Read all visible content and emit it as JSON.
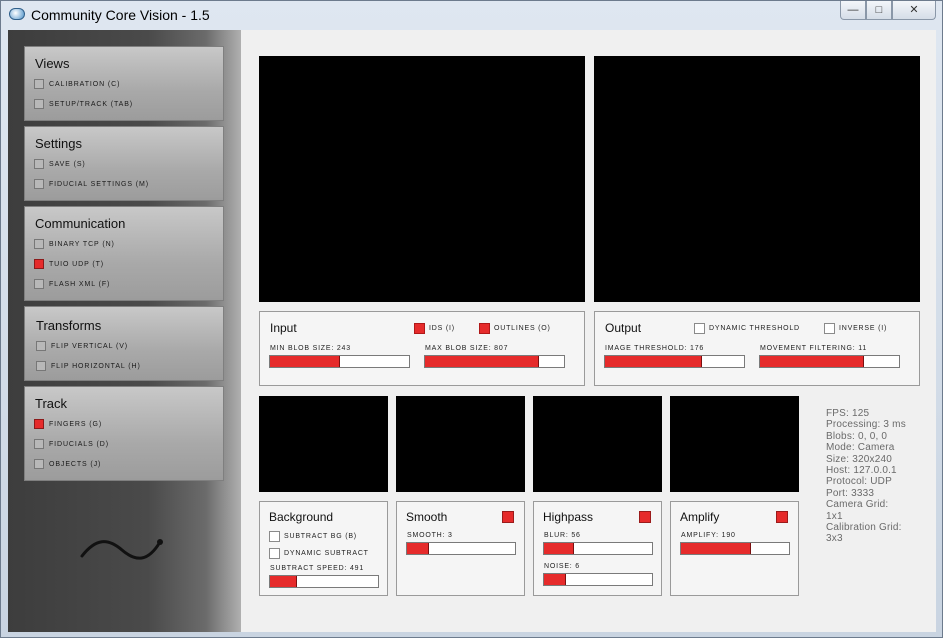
{
  "window": {
    "title": "Community Core Vision - 1.5",
    "controls": {
      "minimize": "—",
      "maximize": "□",
      "close": "✕"
    }
  },
  "colors": {
    "accent": "#e62b2b",
    "sidebar_dark": "#3d3d3d",
    "video_bg": "#000000"
  },
  "sidebar": {
    "panels": [
      {
        "title": "Views",
        "items": [
          {
            "label": "CALIBRATION (C)",
            "checked": false
          },
          {
            "label": "SETUP/TRACK (TAB)",
            "checked": false
          }
        ]
      },
      {
        "title": "Settings",
        "items": [
          {
            "label": "SAVE (S)",
            "checked": false
          },
          {
            "label": "FIDUCIAL SETTINGS (M)",
            "checked": false
          }
        ]
      },
      {
        "title": "Communication",
        "items": [
          {
            "label": "BINARY TCP (N)",
            "checked": false
          },
          {
            "label": "TUIO UDP (T)",
            "checked": true
          },
          {
            "label": "FLASH XML (F)",
            "checked": false
          }
        ]
      },
      {
        "title": "Transforms",
        "items": [
          {
            "label": "FLIP VERTICAL (V)",
            "checked": false
          },
          {
            "label": "FLIP HORIZONTAL (H)",
            "checked": false
          }
        ]
      },
      {
        "title": "Track",
        "items": [
          {
            "label": "FINGERS (G)",
            "checked": true
          },
          {
            "label": "FIDUCIALS (D)",
            "checked": false
          },
          {
            "label": "OBJECTS (J)",
            "checked": false
          }
        ]
      }
    ],
    "logo_icon": "ccv-wave-logo"
  },
  "input_panel": {
    "title": "Input",
    "ids_label": "IDS (I)",
    "ids_checked": true,
    "outlines_label": "OUTLINES (O)",
    "outlines_checked": true,
    "min_blob_label": "MIN BLOB SIZE: 243",
    "min_blob_level": 0.5,
    "max_blob_label": "MAX BLOB SIZE: 807",
    "max_blob_level": 0.82
  },
  "output_panel": {
    "title": "Output",
    "dynamic_threshold_label": "DYNAMIC THRESHOLD",
    "dynamic_threshold_checked": false,
    "inverse_label": "INVERSE (I)",
    "inverse_checked": false,
    "image_threshold_label": "IMAGE THRESHOLD: 176",
    "image_threshold_level": 0.7,
    "movement_filtering_label": "MOVEMENT FILTERING: 11",
    "movement_filtering_level": 0.75
  },
  "filters": {
    "background": {
      "title": "Background",
      "subtract_bg_label": "SUBTRACT BG (B)",
      "subtract_bg_checked": false,
      "dynamic_subtract_label": "DYNAMIC SUBTRACT",
      "dynamic_subtract_checked": false,
      "subtract_speed_label": "SUBTRACT SPEED: 491",
      "subtract_speed_level": 0.25
    },
    "smooth": {
      "title": "Smooth",
      "enabled": true,
      "smooth_label": "SMOOTH: 3",
      "smooth_level": 0.2
    },
    "highpass": {
      "title": "Highpass",
      "enabled": true,
      "blur_label": "BLUR: 56",
      "blur_level": 0.28,
      "noise_label": "NOISE: 6",
      "noise_level": 0.2
    },
    "amplify": {
      "title": "Amplify",
      "enabled": true,
      "amplify_label": "AMPLIFY: 190",
      "amplify_level": 0.65
    }
  },
  "stats": {
    "fps": "FPS: 125",
    "processing": "Processing: 3 ms",
    "blobs": "Blobs: 0, 0, 0",
    "mode": "Mode: Camera",
    "size": "Size: 320x240",
    "host": "Host: 127.0.0.1",
    "protocol": "Protocol: UDP",
    "port": "Port: 3333",
    "camera_grid_label": "Camera Grid:",
    "camera_grid_value": "1x1",
    "calibration_grid_label": "Calibration Grid:",
    "calibration_grid_value": "3x3"
  }
}
